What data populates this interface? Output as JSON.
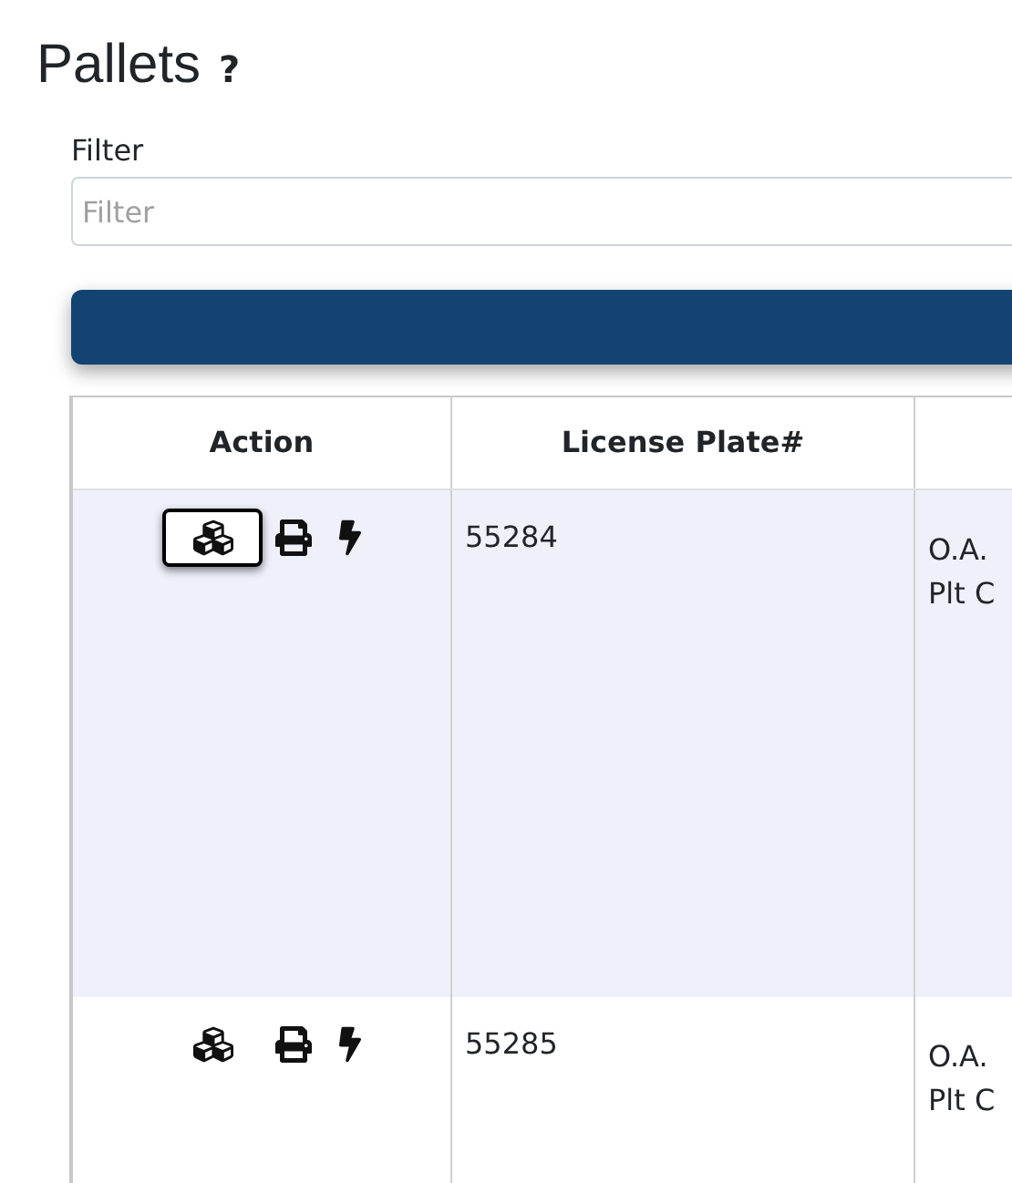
{
  "page": {
    "title": "Pallets",
    "help": "?"
  },
  "filter": {
    "label": "Filter",
    "placeholder": "Filter"
  },
  "table": {
    "columns": [
      "Action",
      "License Plate#"
    ],
    "rows": [
      {
        "highlighted": true,
        "focused": true,
        "license_plate": "55284",
        "column_3": [
          "O.A.",
          "Plt C"
        ]
      },
      {
        "highlighted": false,
        "focused": false,
        "license_plate": "55285",
        "column_3": [
          "O.A.",
          "Plt C"
        ]
      }
    ]
  }
}
